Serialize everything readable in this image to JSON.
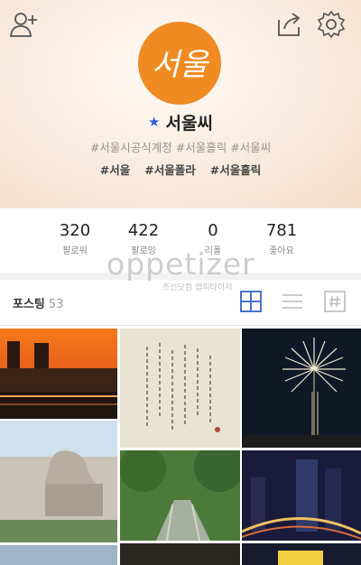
{
  "header": {
    "icons": {
      "left": "add-friend-icon",
      "right": [
        "share-icon",
        "settings-icon"
      ]
    },
    "logo_text": "서울",
    "profile_name": "서울씨",
    "verified_badge": "★",
    "hashtags_line1": "#서울시공식계정 #서울흘릭 #서울씨",
    "hashtags_line2": [
      "#서울",
      "#서울폴라",
      "#서울흘릭"
    ],
    "accent_color": "#f08a22"
  },
  "stats": [
    {
      "value": "320",
      "label": "팔로워"
    },
    {
      "value": "422",
      "label": "팔로잉"
    },
    {
      "value": "0",
      "label": "리폴"
    },
    {
      "value": "781",
      "label": "좋아요"
    }
  ],
  "watermark": {
    "main": "oppetizer",
    "sub": "조선닷컴 앱피타이저"
  },
  "posts_bar": {
    "label": "포스팅",
    "count": "53",
    "view_icons": [
      "grid-view-icon",
      "list-view-icon",
      "hashtag-view-icon"
    ],
    "active_color": "#4a74c9"
  },
  "photos": [
    "city-sunset-photo",
    "calligraphy-photo",
    "fireworks-photo",
    "haechi-statue-photo",
    "garden-stream-photo",
    "night-city-photo"
  ]
}
